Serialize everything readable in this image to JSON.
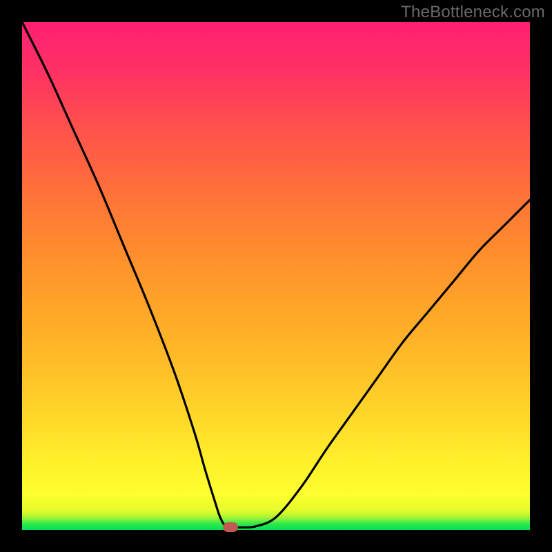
{
  "watermark": "TheBottleneck.com",
  "chart_data": {
    "type": "line",
    "title": "",
    "xlabel": "",
    "ylabel": "",
    "xlim": [
      0,
      100
    ],
    "ylim": [
      0,
      100
    ],
    "grid": false,
    "legend": false,
    "series": [
      {
        "name": "curve",
        "x": [
          0,
          5,
          10,
          15,
          20,
          25,
          30,
          34,
          36,
          38,
          39,
          40,
          41,
          43,
          46,
          50,
          55,
          60,
          65,
          70,
          75,
          80,
          85,
          90,
          95,
          100
        ],
        "values": [
          100,
          90,
          79,
          68,
          56,
          44,
          31,
          19,
          12,
          5.5,
          2.5,
          0.8,
          0.5,
          0.5,
          0.7,
          2.5,
          8.5,
          16,
          23,
          30,
          37,
          43,
          49,
          55,
          60,
          65
        ]
      }
    ],
    "marker": {
      "x": 41,
      "y": 0.5
    },
    "gradient_stops": [
      {
        "pos": 0.0,
        "color": "#00e255"
      },
      {
        "pos": 0.05,
        "color": "#fdff2f"
      },
      {
        "pos": 0.5,
        "color": "#ffa528"
      },
      {
        "pos": 1.0,
        "color": "#ff1f73"
      }
    ]
  }
}
